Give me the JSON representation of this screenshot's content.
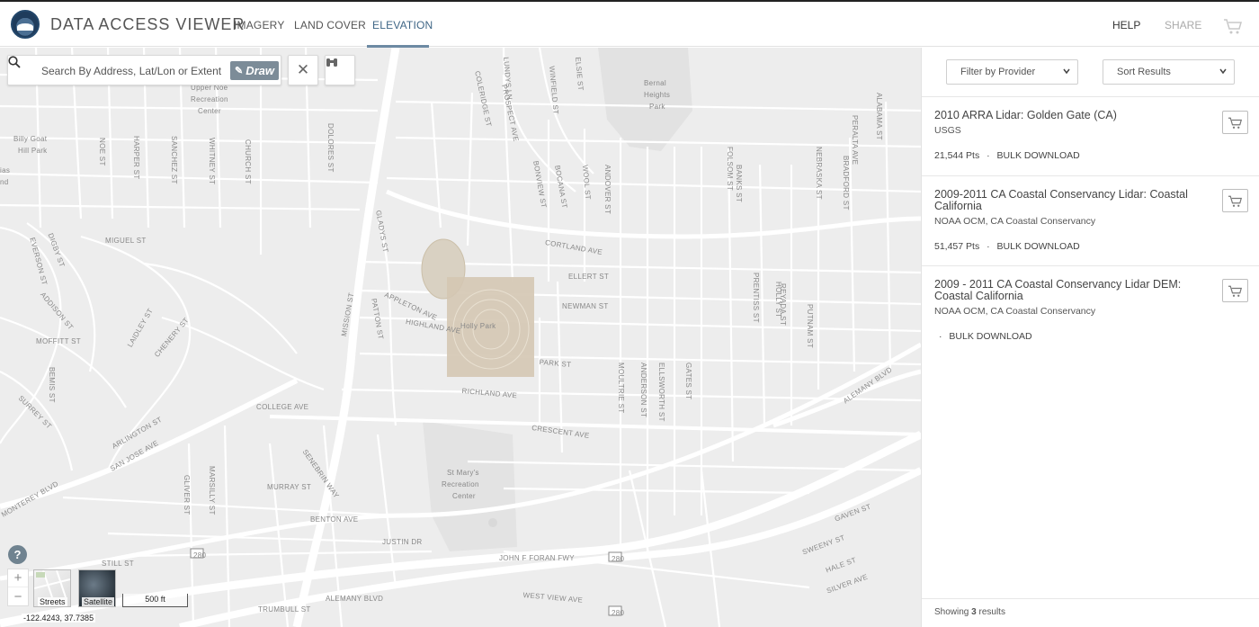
{
  "header": {
    "app_title": "DATA ACCESS VIEWER",
    "logo_text": "NOAA",
    "tabs": [
      {
        "label": "IMAGERY",
        "active": false
      },
      {
        "label": "LAND COVER",
        "active": false
      },
      {
        "label": "ELEVATION",
        "active": true
      }
    ],
    "help_label": "HELP",
    "share_label": "SHARE",
    "cart_icon": "cart-icon"
  },
  "map": {
    "search_placeholder": "Search By Address, Lat/Lon or Extent",
    "draw_label": "Draw",
    "clear_icon": "close-icon",
    "identify_icon": "binoculars-icon",
    "help_label": "?",
    "zoom_in": "+",
    "zoom_out": "−",
    "basemaps": [
      "Streets",
      "Satellite"
    ],
    "scale_label": "500 ft",
    "coordinates": "-122.4243, 37.7385",
    "streets": [
      "DAY ST",
      "Upper Noe",
      "Recreation",
      "Center",
      "Billy Goat",
      "Hill Park",
      "ias",
      "nd",
      "NOE ST",
      "HARPER ST",
      "SANCHEZ ST",
      "WHITNEY ST",
      "CHURCH ST",
      "DOLORES ST",
      "COLERIDGE ST",
      "LUNDYS LN",
      "PROSPECT AVE",
      "WINFIELD ST",
      "ELSIE ST",
      "Bernal",
      "Heights",
      "Park",
      "ALABAMA ST",
      "PERALTA AVE",
      "BOCANA ST",
      "WOOL ST",
      "ANDOVER ST",
      "FOLSOM ST",
      "BANKS ST",
      "NEBRASKA ST",
      "BRADFORD ST",
      "BONVIEW ST",
      "GLADYS ST",
      "EVERSON ST",
      "DIGBY ST",
      "MIGUEL ST",
      "ADDISON ST",
      "MOFFITT ST",
      "LAIDLEY ST",
      "CHENERY ST",
      "BEMIS ST",
      "SURREY ST",
      "CORTLAND AVE",
      "ELLERT ST",
      "NEWMAN ST",
      "APPLETON AVE",
      "PATTON ST",
      "HIGHLAND AVE",
      "Holly Park",
      "PARK ST",
      "RICHLAND AVE",
      "MISSION ST",
      "PRENTISS ST",
      "HOLLY ST",
      "PUTNAM ST",
      "REYADA ST",
      "ALEMANY BLVD",
      "COLLEGE AVE",
      "CRESCENT AVE",
      "MOULTRIE ST",
      "ANDERSON ST",
      "ELLSWORTH ST",
      "GATES ST",
      "ARLINGTON ST",
      "SAN JOSE AVE",
      "SENEBRIN WAY",
      "GLIVER ST",
      "MARSILLY ST",
      "MURRAY ST",
      "St Mary's",
      "Recreation",
      "Center",
      "JOHN F FORAN FWY",
      "MONTEREY BLVD",
      "BENTON AVE",
      "JUSTIN DR",
      "GAVEN ST",
      "SWEENY ST",
      "HALE ST",
      "SILVER AVE",
      "STILL ST",
      "ALEMANY BLVD",
      "TRUMBULL ST",
      "WEST VIEW AVE",
      "280",
      "280",
      "280"
    ]
  },
  "panel": {
    "filter_label": "Filter by Provider",
    "sort_label": "Sort Results",
    "results": [
      {
        "title": "2010 ARRA Lidar: Golden Gate (CA)",
        "provider": "USGS",
        "count": "21,544 Pts",
        "action": "BULK DOWNLOAD"
      },
      {
        "title": "2009-2011 CA Coastal Conservancy Lidar: Coastal California",
        "provider": "NOAA OCM, CA Coastal Conservancy",
        "count": "51,457 Pts",
        "action": "BULK DOWNLOAD"
      },
      {
        "title": "2009 - 2011 CA Coastal Conservancy Lidar DEM: Coastal California",
        "provider": "NOAA OCM, CA Coastal Conservancy",
        "count": "",
        "action": "BULK DOWNLOAD"
      }
    ],
    "showing_prefix": "Showing",
    "showing_count": "3",
    "showing_suffix": "results"
  },
  "colors": {
    "map_bg": "#ededed",
    "road": "#ffffff",
    "highlight_box": "#d4c7b2",
    "active_tab": "#3f6686",
    "draw_button": "#7c8c98"
  }
}
